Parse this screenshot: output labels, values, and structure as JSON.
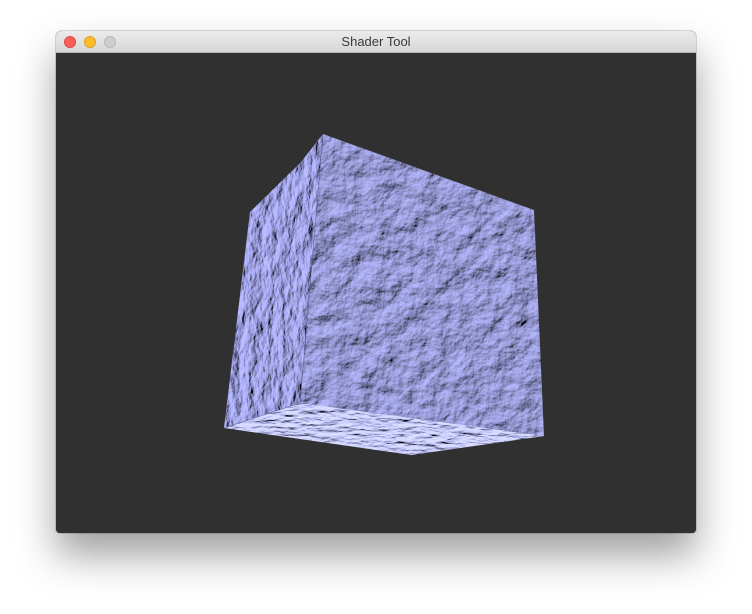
{
  "window": {
    "title": "Shader Tool"
  },
  "titlebar": {
    "buttons": [
      "close",
      "minimize",
      "zoom"
    ]
  },
  "viewport": {
    "background_color": "#303030",
    "object": "textured-cube",
    "material_color": "#8e90e2"
  }
}
